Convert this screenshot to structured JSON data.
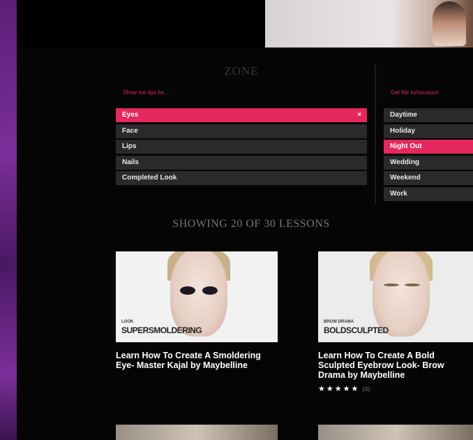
{
  "filter": {
    "title": "ZONE",
    "zone_prompt": "Show me tips for...",
    "zones": [
      {
        "label": "Eyes",
        "selected": true
      },
      {
        "label": "Face",
        "selected": false
      },
      {
        "label": "Lips",
        "selected": false
      },
      {
        "label": "Nails",
        "selected": false
      },
      {
        "label": "Completed Look",
        "selected": false
      }
    ],
    "clear_glyph": "×",
    "occasion_prompt": "Get Me to/occasion",
    "occasions": [
      {
        "label": "Daytime",
        "selected": false
      },
      {
        "label": "Holiday",
        "selected": false
      },
      {
        "label": "Night Out",
        "selected": true
      },
      {
        "label": "Wedding",
        "selected": false
      },
      {
        "label": "Weekend",
        "selected": false
      },
      {
        "label": "Work",
        "selected": false
      }
    ]
  },
  "results": {
    "count_text": "SHOWING 20 OF 30 LESSONS"
  },
  "lessons": [
    {
      "thumb_small": "LOOK",
      "thumb_caption": "SUPERSMOLDERING",
      "title": "Learn How To Create A Smoldering Eye- Master Kajal by Maybelline"
    },
    {
      "thumb_small": "BROW DRAMA",
      "thumb_caption": "BOLDSCULPTED",
      "title": "Learn How To Create A Bold Sculpted Eyebrow Look- Brow Drama by Maybelline",
      "stars": "★★★★★",
      "rating_count": "(4)"
    }
  ],
  "colors": {
    "accent": "#e5285e",
    "item_bg": "#2a2a2a",
    "background": "#050505"
  }
}
